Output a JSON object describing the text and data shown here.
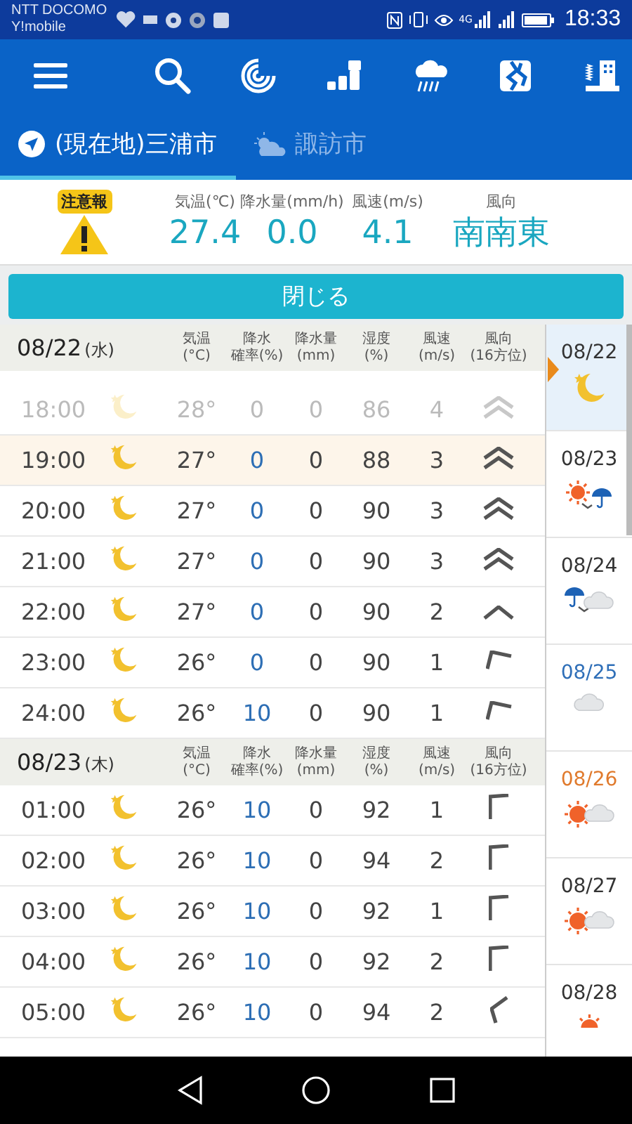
{
  "status_bar": {
    "carriers": [
      "NTT DOCOMO",
      "Y!mobile"
    ],
    "network": "4G",
    "time": "18:33"
  },
  "toolbar": {
    "buttons": [
      {
        "kind": "menu"
      },
      {
        "kind": "search"
      },
      {
        "kind": "typhoon"
      },
      {
        "kind": "steps"
      },
      {
        "kind": "rain"
      },
      {
        "kind": "map"
      },
      {
        "kind": "building"
      }
    ]
  },
  "tabs": [
    {
      "label": "(現在地)三浦市",
      "kind": "location",
      "selected": true
    },
    {
      "label": "諏訪市",
      "kind": "weather",
      "selected": false
    }
  ],
  "current": {
    "alert": "注意報",
    "items": [
      {
        "label": "気温(℃)",
        "value": "27.4"
      },
      {
        "label": "降水量(mm/h)",
        "value": "0.0"
      },
      {
        "label": "風速(m/s)",
        "value": "4.1"
      },
      {
        "label": "風向",
        "value": "南南東"
      }
    ]
  },
  "close_button": "閉じる",
  "days": [
    {
      "date": "08/22",
      "weekday": "(水)",
      "columns": [
        {
          "lines": [
            "気温",
            "(°C)"
          ]
        },
        {
          "lines": [
            "降水",
            "確率(%)"
          ]
        },
        {
          "lines": [
            "降水量",
            "(mm)"
          ]
        },
        {
          "lines": [
            "湿度",
            "(%)"
          ]
        },
        {
          "lines": [
            "風速",
            "(m/s)"
          ]
        },
        {
          "lines": [
            "風向",
            "(16方位)"
          ]
        }
      ],
      "rows": [
        {
          "time": "18:00",
          "icon": {
            "kind": "moon"
          },
          "temp": "28°",
          "prob": "0",
          "amount": "0",
          "humidity": "86",
          "wind": "4",
          "direction": {
            "kind": "double"
          },
          "past": true,
          "selected": false
        },
        {
          "time": "19:00",
          "icon": {
            "kind": "moon"
          },
          "temp": "27°",
          "prob": "0",
          "amount": "0",
          "humidity": "88",
          "wind": "3",
          "direction": {
            "kind": "double"
          },
          "past": false,
          "selected": true
        },
        {
          "time": "20:00",
          "icon": {
            "kind": "moon"
          },
          "temp": "27°",
          "prob": "0",
          "amount": "0",
          "humidity": "90",
          "wind": "3",
          "direction": {
            "kind": "double"
          },
          "past": false,
          "selected": false
        },
        {
          "time": "21:00",
          "icon": {
            "kind": "moon"
          },
          "temp": "27°",
          "prob": "0",
          "amount": "0",
          "humidity": "90",
          "wind": "3",
          "direction": {
            "kind": "double"
          },
          "past": false,
          "selected": false
        },
        {
          "time": "22:00",
          "icon": {
            "kind": "moon"
          },
          "temp": "27°",
          "prob": "0",
          "amount": "0",
          "humidity": "90",
          "wind": "2",
          "direction": {
            "kind": "single"
          },
          "past": false,
          "selected": false
        },
        {
          "time": "23:00",
          "icon": {
            "kind": "moon"
          },
          "temp": "26°",
          "prob": "0",
          "amount": "0",
          "humidity": "90",
          "wind": "1",
          "direction": {
            "kind": "bent"
          },
          "past": false,
          "selected": false
        },
        {
          "time": "24:00",
          "icon": {
            "kind": "moon"
          },
          "temp": "26°",
          "prob": "10",
          "amount": "0",
          "humidity": "90",
          "wind": "1",
          "direction": {
            "kind": "bent"
          },
          "past": false,
          "selected": false
        }
      ]
    },
    {
      "date": "08/23",
      "weekday": "(木)",
      "columns": [
        {
          "lines": [
            "気温",
            "(°C)"
          ]
        },
        {
          "lines": [
            "降水",
            "確率(%)"
          ]
        },
        {
          "lines": [
            "降水量",
            "(mm)"
          ]
        },
        {
          "lines": [
            "湿度",
            "(%)"
          ]
        },
        {
          "lines": [
            "風速",
            "(m/s)"
          ]
        },
        {
          "lines": [
            "風向",
            "(16方位)"
          ]
        }
      ],
      "rows": [
        {
          "time": "01:00",
          "icon": {
            "kind": "moon"
          },
          "temp": "26°",
          "prob": "10",
          "amount": "0",
          "humidity": "92",
          "wind": "1",
          "direction": {
            "kind": "corner"
          },
          "past": false,
          "selected": false
        },
        {
          "time": "02:00",
          "icon": {
            "kind": "moon"
          },
          "temp": "26°",
          "prob": "10",
          "amount": "0",
          "humidity": "94",
          "wind": "2",
          "direction": {
            "kind": "corner"
          },
          "past": false,
          "selected": false
        },
        {
          "time": "03:00",
          "icon": {
            "kind": "moon"
          },
          "temp": "26°",
          "prob": "10",
          "amount": "0",
          "humidity": "92",
          "wind": "1",
          "direction": {
            "kind": "corner"
          },
          "past": false,
          "selected": false
        },
        {
          "time": "04:00",
          "icon": {
            "kind": "moon"
          },
          "temp": "26°",
          "prob": "10",
          "amount": "0",
          "humidity": "92",
          "wind": "2",
          "direction": {
            "kind": "corner"
          },
          "past": false,
          "selected": false
        },
        {
          "time": "05:00",
          "icon": {
            "kind": "moon"
          },
          "temp": "26°",
          "prob": "10",
          "amount": "0",
          "humidity": "94",
          "wind": "2",
          "direction": {
            "kind": "tilted"
          },
          "past": false,
          "selected": false
        }
      ]
    }
  ],
  "week": [
    {
      "date": "08/22",
      "color": "#333333",
      "icon": {
        "kind": "moon"
      },
      "selected": true
    },
    {
      "date": "08/23",
      "color": "#333333",
      "icon": {
        "kind": "sunrain"
      },
      "selected": false
    },
    {
      "date": "08/24",
      "color": "#333333",
      "icon": {
        "kind": "raincloud"
      },
      "selected": false
    },
    {
      "date": "08/25",
      "color": "#2f6fb8",
      "icon": {
        "kind": "cloud"
      },
      "selected": false
    },
    {
      "date": "08/26",
      "color": "#e07a2c",
      "icon": {
        "kind": "suncloud"
      },
      "selected": false
    },
    {
      "date": "08/27",
      "color": "#333333",
      "icon": {
        "kind": "suncloud"
      },
      "selected": false
    },
    {
      "date": "08/28",
      "color": "#333333",
      "icon": {
        "kind": "sun"
      },
      "selected": false
    }
  ]
}
